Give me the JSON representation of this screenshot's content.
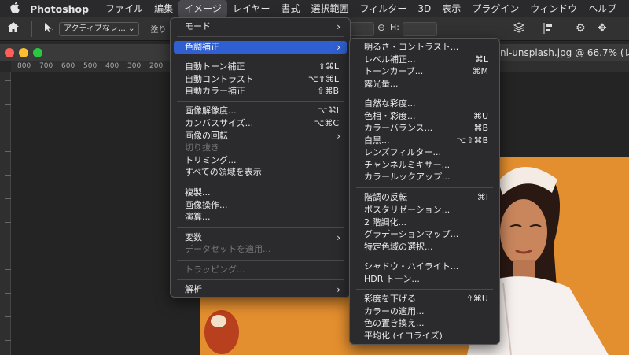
{
  "menubar": {
    "apple_glyph": "",
    "app_name": "Photoshop",
    "items": [
      "ファイル",
      "編集",
      "イメージ",
      "レイヤー",
      "書式",
      "選択範囲",
      "フィルター",
      "3D",
      "表示",
      "プラグイン",
      "ウィンドウ",
      "ヘルプ"
    ]
  },
  "options_bar": {
    "tool_preset": "アクティブなレ…",
    "paint_label": "塗り",
    "home_icon": "home-icon",
    "move_icon": "move-arrow-icon"
  },
  "document": {
    "title": "nl-unsplash.jpg @ 66.7% (レ",
    "ruler_ticks": [
      "800",
      "700",
      "600",
      "500",
      "400",
      "300",
      "200"
    ]
  },
  "image_menu": {
    "items": [
      {
        "label": "モード",
        "submenu": true
      },
      {
        "label": "色調補正",
        "submenu": true,
        "highlighted": true
      },
      {
        "label": "自動トーン補正",
        "shortcut": "⇧⌘L"
      },
      {
        "label": "自動コントラスト",
        "shortcut": "⌥⇧⌘L"
      },
      {
        "label": "自動カラー補正",
        "shortcut": "⇧⌘B"
      },
      {
        "label": "画像解像度...",
        "shortcut": "⌥⌘I"
      },
      {
        "label": "カンバスサイズ...",
        "shortcut": "⌥⌘C"
      },
      {
        "label": "画像の回転",
        "submenu": true
      },
      {
        "label": "切り抜き",
        "disabled": true
      },
      {
        "label": "トリミング..."
      },
      {
        "label": "すべての領域を表示"
      },
      {
        "label": "複製..."
      },
      {
        "label": "画像操作..."
      },
      {
        "label": "演算..."
      },
      {
        "label": "変数",
        "submenu": true
      },
      {
        "label": "データセットを適用...",
        "disabled": true
      },
      {
        "label": "トラッピング...",
        "disabled": true
      },
      {
        "label": "解析",
        "submenu": true
      }
    ]
  },
  "adjustments_menu": {
    "items": [
      {
        "label": "明るさ・コントラスト..."
      },
      {
        "label": "レベル補正...",
        "shortcut": "⌘L"
      },
      {
        "label": "トーンカーブ...",
        "shortcut": "⌘M"
      },
      {
        "label": "露光量..."
      },
      {
        "label": "自然な彩度..."
      },
      {
        "label": "色相・彩度...",
        "shortcut": "⌘U"
      },
      {
        "label": "カラーバランス...",
        "shortcut": "⌘B"
      },
      {
        "label": "白黒...",
        "shortcut": "⌥⇧⌘B"
      },
      {
        "label": "レンズフィルター..."
      },
      {
        "label": "チャンネルミキサー..."
      },
      {
        "label": "カラールックアップ..."
      },
      {
        "label": "階調の反転",
        "shortcut": "⌘I"
      },
      {
        "label": "ポスタリゼーション..."
      },
      {
        "label": "2 階調化..."
      },
      {
        "label": "グラデーションマップ..."
      },
      {
        "label": "特定色域の選択..."
      },
      {
        "label": "シャドウ・ハイライト..."
      },
      {
        "label": "HDR トーン..."
      },
      {
        "label": "彩度を下げる",
        "shortcut": "⇧⌘U"
      },
      {
        "label": "カラーの適用..."
      },
      {
        "label": "色の置き換え..."
      },
      {
        "label": "平均化 (イコライズ)"
      }
    ]
  },
  "colors": {
    "menu_bg": "#2b2b2e",
    "highlight": "#2f5fd0",
    "photo_bg": "#e08a2a"
  }
}
